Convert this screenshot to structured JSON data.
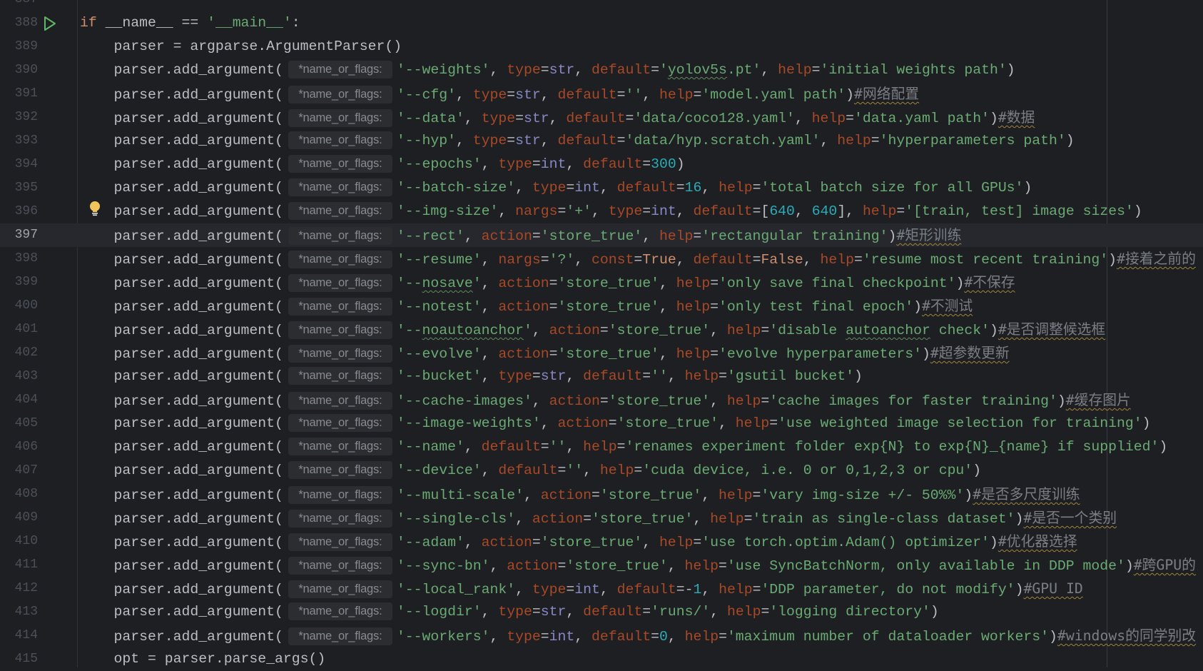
{
  "editor": {
    "hint_label": "*name_or_flags:",
    "current_line": 397,
    "run_icon_line": 388,
    "bulb_icon_line": 396,
    "colors": {
      "background": "#1e1f22",
      "string": "#6aab73",
      "number": "#2aacb8",
      "keyword": "#cf8e6d",
      "kwarg": "#aa4926",
      "builtin": "#8888c6",
      "comment": "#7a7e85"
    },
    "lines": [
      {
        "n": "387",
        "code": "",
        "hint": false,
        "comment": ""
      },
      {
        "n": "388",
        "code": "if __name__ == '__main__':",
        "hint": false,
        "comment": ""
      },
      {
        "n": "389",
        "code": "    parser = argparse.ArgumentParser()",
        "hint": false,
        "comment": ""
      },
      {
        "n": "390",
        "code": "'--weights', type=str, default='yolov5s.pt', help='initial weights path')",
        "hint": true,
        "comment": ""
      },
      {
        "n": "391",
        "code": "'--cfg', type=str, default='', help='model.yaml path')",
        "hint": true,
        "comment": "#网络配置"
      },
      {
        "n": "392",
        "code": "'--data', type=str, default='data/coco128.yaml', help='data.yaml path')",
        "hint": true,
        "comment": "#数据"
      },
      {
        "n": "393",
        "code": "'--hyp', type=str, default='data/hyp.scratch.yaml', help='hyperparameters path')",
        "hint": true,
        "comment": ""
      },
      {
        "n": "394",
        "code": "'--epochs', type=int, default=300)",
        "hint": true,
        "comment": ""
      },
      {
        "n": "395",
        "code": "'--batch-size', type=int, default=16, help='total batch size for all GPUs')",
        "hint": true,
        "comment": ""
      },
      {
        "n": "396",
        "code": "'--img-size', nargs='+', type=int, default=[640, 640], help='[train, test] image sizes')",
        "hint": true,
        "comment": ""
      },
      {
        "n": "397",
        "code": "'--rect', action='store_true', help='rectangular training')",
        "hint": true,
        "comment": "#矩形训练"
      },
      {
        "n": "398",
        "code": "'--resume', nargs='?', const=True, default=False, help='resume most recent training')",
        "hint": true,
        "comment": "#接着之前的"
      },
      {
        "n": "399",
        "code": "'--nosave', action='store_true', help='only save final checkpoint')",
        "hint": true,
        "comment": "#不保存"
      },
      {
        "n": "400",
        "code": "'--notest', action='store_true', help='only test final epoch')",
        "hint": true,
        "comment": "#不测试"
      },
      {
        "n": "401",
        "code": "'--noautoanchor', action='store_true', help='disable autoanchor check')",
        "hint": true,
        "comment": "#是否调整候选框"
      },
      {
        "n": "402",
        "code": "'--evolve', action='store_true', help='evolve hyperparameters')",
        "hint": true,
        "comment": "#超参数更新"
      },
      {
        "n": "403",
        "code": "'--bucket', type=str, default='', help='gsutil bucket')",
        "hint": true,
        "comment": ""
      },
      {
        "n": "404",
        "code": "'--cache-images', action='store_true', help='cache images for faster training')",
        "hint": true,
        "comment": "#缓存图片"
      },
      {
        "n": "405",
        "code": "'--image-weights', action='store_true', help='use weighted image selection for training')",
        "hint": true,
        "comment": ""
      },
      {
        "n": "406",
        "code": "'--name', default='', help='renames experiment folder exp{N} to exp{N}_{name} if supplied')",
        "hint": true,
        "comment": ""
      },
      {
        "n": "407",
        "code": "'--device', default='', help='cuda device, i.e. 0 or 0,1,2,3 or cpu')",
        "hint": true,
        "comment": ""
      },
      {
        "n": "408",
        "code": "'--multi-scale', action='store_true', help='vary img-size +/- 50%%')",
        "hint": true,
        "comment": "#是否多尺度训练"
      },
      {
        "n": "409",
        "code": "'--single-cls', action='store_true', help='train as single-class dataset')",
        "hint": true,
        "comment": "#是否一个类别"
      },
      {
        "n": "410",
        "code": "'--adam', action='store_true', help='use torch.optim.Adam() optimizer')",
        "hint": true,
        "comment": "#优化器选择"
      },
      {
        "n": "411",
        "code": "'--sync-bn', action='store_true', help='use SyncBatchNorm, only available in DDP mode')",
        "hint": true,
        "comment": "#跨GPU的"
      },
      {
        "n": "412",
        "code": "'--local_rank', type=int, default=-1, help='DDP parameter, do not modify')",
        "hint": true,
        "comment": "#GPU ID"
      },
      {
        "n": "413",
        "code": "'--logdir', type=str, default='runs/', help='logging directory')",
        "hint": true,
        "comment": ""
      },
      {
        "n": "414",
        "code": "'--workers', type=int, default=0, help='maximum number of dataloader workers')",
        "hint": true,
        "comment": "#windows的同学别改"
      },
      {
        "n": "415",
        "code": "    opt = parser.parse_args()",
        "hint": false,
        "comment": ""
      }
    ],
    "call_prefix": "    parser.add_argument("
  }
}
